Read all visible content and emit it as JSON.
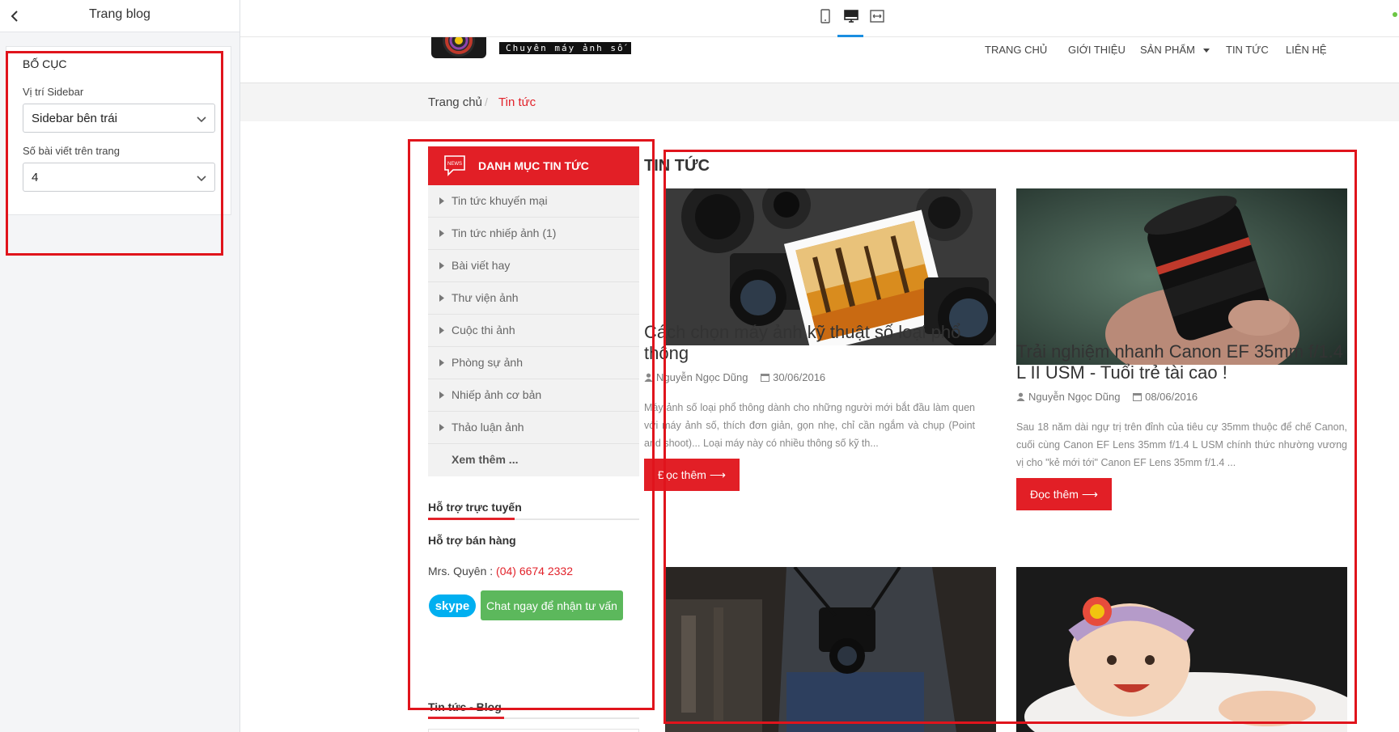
{
  "panel": {
    "title": "Trang blog",
    "layout_section": {
      "title": "BỐ CỤC",
      "sidebar_position": {
        "label": "Vị trí Sidebar",
        "value": "Sidebar bên trái"
      },
      "posts_per_page": {
        "label": "Số bài viết trên trang",
        "value": "4"
      }
    }
  },
  "toolbar": {
    "icons": [
      "mobile-view-icon",
      "desktop-view-icon",
      "fullwidth-view-icon"
    ],
    "active": "desktop-view-icon"
  },
  "site": {
    "logo_tagline": "Chuyên máy ảnh số",
    "nav": [
      "TRANG CHỦ",
      "GIỚI THIỆU",
      "SẢN PHẨM",
      "TIN TỨC",
      "LIÊN HỆ"
    ],
    "breadcrumb": {
      "home": "Trang chủ",
      "separator": "/",
      "current": "Tin tức"
    },
    "category_box": {
      "title": "DANH MỤC TIN TỨC",
      "items": [
        "Tin tức khuyến mại",
        "Tin tức nhiếp ảnh (1)",
        "Bài viết hay",
        "Thư viện ảnh",
        "Cuộc thi ảnh",
        "Phòng sự ảnh",
        "Nhiếp ảnh cơ bản",
        "Thảo luận ảnh"
      ],
      "more": "Xem thêm ..."
    },
    "support": {
      "heading": "Hỗ trợ trực tuyến",
      "subheading": "Hỗ trợ bán hàng",
      "contact_name": "Mrs. Quyên :",
      "contact_phone": "(04) 6674 2332",
      "skype_label": "skype",
      "chat_button": "Chat ngay để nhận tư vấn"
    },
    "blog_heading": "Tin tức - Blog",
    "news": {
      "title": "TIN TỨC",
      "posts": [
        {
          "title": "Cách chọn máy ảnh kỹ thuật số loại phổ thông",
          "author": "Nguyễn Ngọc Dũng",
          "date": "30/06/2016",
          "excerpt": "Máy ảnh số loại phổ thông dành cho những người mới bắt đầu làm quen với máy ảnh số, thích đơn giản, gọn nhẹ, chỉ cần ngắm và chụp (Point and shoot)... Loại máy này có nhiều thông số kỹ th...",
          "read_more": "Đọc thêm"
        },
        {
          "title": "Trải nghiệm nhanh Canon EF 35mm f/1.4 L II USM - Tuổi trẻ tài cao !",
          "author": "Nguyễn Ngọc Dũng",
          "date": "08/06/2016",
          "excerpt": "Sau 18 năm dài ngự trị trên đỉnh của tiêu cự 35mm thuộc để chế Canon, cuối cùng Canon EF Lens 35mm f/1.4 L USM chính thức nhường vương vị cho \"kẻ mới tới\" Canon EF Lens 35mm f/1.4 ...",
          "read_more": "Đọc thêm"
        }
      ]
    }
  },
  "colors": {
    "accent_red": "#e21f26",
    "annotation_red": "#e0141c",
    "chat_green": "#5cb85c",
    "toolbar_active_blue": "#1a8ee0"
  }
}
